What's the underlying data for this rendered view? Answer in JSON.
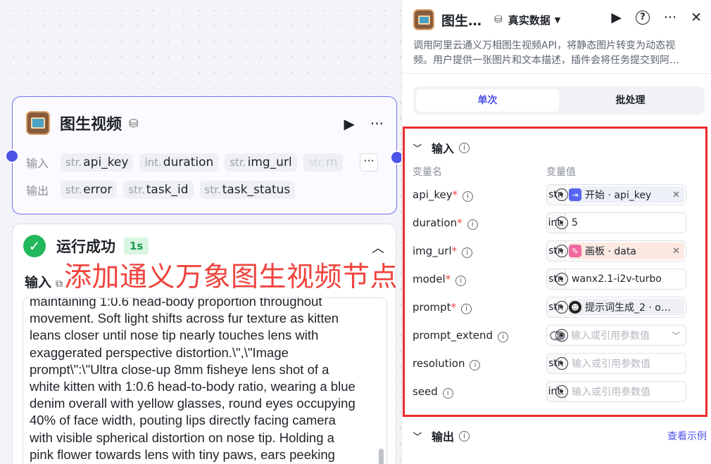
{
  "node": {
    "title": "图生视频",
    "input_label": "输入",
    "output_label": "输出",
    "inputs": [
      {
        "type": "str.",
        "name": "api_key"
      },
      {
        "type": "int.",
        "name": "duration"
      },
      {
        "type": "str.",
        "name": "img_url"
      },
      {
        "type": "str.",
        "name": "m"
      }
    ],
    "outputs": [
      {
        "type": "str.",
        "name": "error"
      },
      {
        "type": "str.",
        "name": "task_id"
      },
      {
        "type": "str.",
        "name": "task_status"
      }
    ],
    "more_label": "···"
  },
  "run": {
    "status": "运行成功",
    "duration_badge": "1s",
    "input_label": "输入",
    "overlay_caption": "添加通义万象图生视频节点",
    "input_lines": [
      "maintaining 1:0.6 head-body proportion throughout",
      "movement. Soft light shifts across fur texture as kitten",
      "leans closer until nose tip nearly touches lens with",
      "exaggerated perspective distortion.\\\",\\\"Image",
      "prompt\\\":\\\"Ultra close-up 8mm fisheye lens shot of a",
      "white kitten with 1:0.6 head-to-body ratio, wearing a blue",
      "denim overall with yellow glasses, round eyes occupying",
      "40% of face width, pouting lips directly facing camera",
      "with visible spherical distortion on nose tip. Holding a",
      "pink flower towards lens with tiny paws, ears peeking"
    ]
  },
  "panel": {
    "title": "图生…",
    "mode": "真实数据",
    "description": [
      "调用阿里云通义万相图生视频API，将静态图片转变为动态视",
      "频。用户提供一张图片和文本描述，插件会将任务提交到阿…"
    ],
    "tabs": [
      {
        "label": "单次",
        "active": true
      },
      {
        "label": "批处理",
        "active": false
      }
    ],
    "input_section": "输入",
    "col_name": "变量名",
    "col_value": "变量值",
    "params": [
      {
        "name": "api_key",
        "required": true,
        "type": "str.",
        "kind": "ref",
        "color": "blue",
        "value": "开始 · api_key"
      },
      {
        "name": "duration",
        "required": true,
        "type": "int.",
        "kind": "value",
        "value": "5"
      },
      {
        "name": "img_url",
        "required": true,
        "type": "str.",
        "kind": "ref",
        "color": "pink",
        "value": "画板 · data"
      },
      {
        "name": "model",
        "required": true,
        "type": "str.",
        "kind": "value",
        "value": "wanx2.1-i2v-turbo"
      },
      {
        "name": "prompt",
        "required": true,
        "type": "str.",
        "kind": "ref",
        "color": "gray",
        "value": "提示词生成_2 · o…"
      },
      {
        "name": "prompt_extend",
        "required": false,
        "type": "",
        "kind": "toggle",
        "placeholder": "输入或引用参数值"
      },
      {
        "name": "resolution",
        "required": false,
        "type": "str.",
        "kind": "empty",
        "placeholder": "输入或引用参数值"
      },
      {
        "name": "seed",
        "required": false,
        "type": "int.",
        "kind": "empty",
        "placeholder": "输入或引用参数值"
      }
    ],
    "output_section": "输出",
    "example_link": "查看示例"
  }
}
